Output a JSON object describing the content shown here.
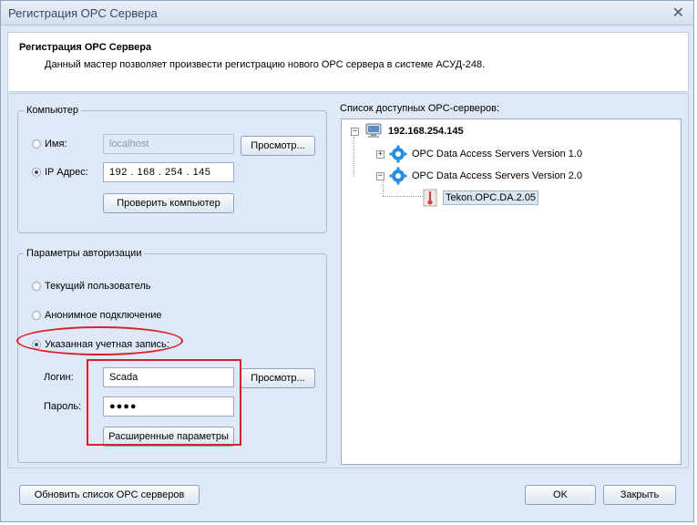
{
  "window": {
    "title": "Регистрация OPC Сервера",
    "close_glyph": "✕"
  },
  "header": {
    "title": "Регистрация OPC Сервера",
    "description": "Данный мастер позволяет произвести регистрацию нового OPC сервера в системе АСУД-248."
  },
  "computer": {
    "legend": "Компьютер",
    "name_label": "Имя:",
    "name_value": "localhost",
    "browse_label": "Просмотр...",
    "ip_label": "IP Адрес:",
    "ip_value": "192 . 168 . 254 . 145",
    "check_label": "Проверить компьютер",
    "selected": "ip"
  },
  "auth": {
    "legend": "Параметры авторизации",
    "current_user": "Текущий пользователь",
    "anonymous": "Анонимное подключение",
    "specified": "Указанная учетная запись:",
    "selected": "specified",
    "login_label": "Логин:",
    "login_value": "Scada",
    "browse_label": "Просмотр...",
    "password_label": "Пароль:",
    "password_value": "●●●●",
    "advanced_label": "Расширенные параметры"
  },
  "servers": {
    "title": "Список доступных OPC-серверов:",
    "root": "192.168.254.145",
    "items": [
      {
        "label": "OPC Data Access Servers Version 1.0",
        "expander": "+"
      },
      {
        "label": "OPC Data Access Servers Version 2.0",
        "expander": "−"
      }
    ],
    "leaf": "Tekon.OPC.DA.2.05"
  },
  "footer": {
    "refresh_label": "Обновить список OPC серверов",
    "ok_label": "OK",
    "close_label": "Закрыть"
  },
  "colors": {
    "highlight": "#d9202a",
    "panel": "#dfe8f6",
    "accent": "#1e73c8"
  }
}
